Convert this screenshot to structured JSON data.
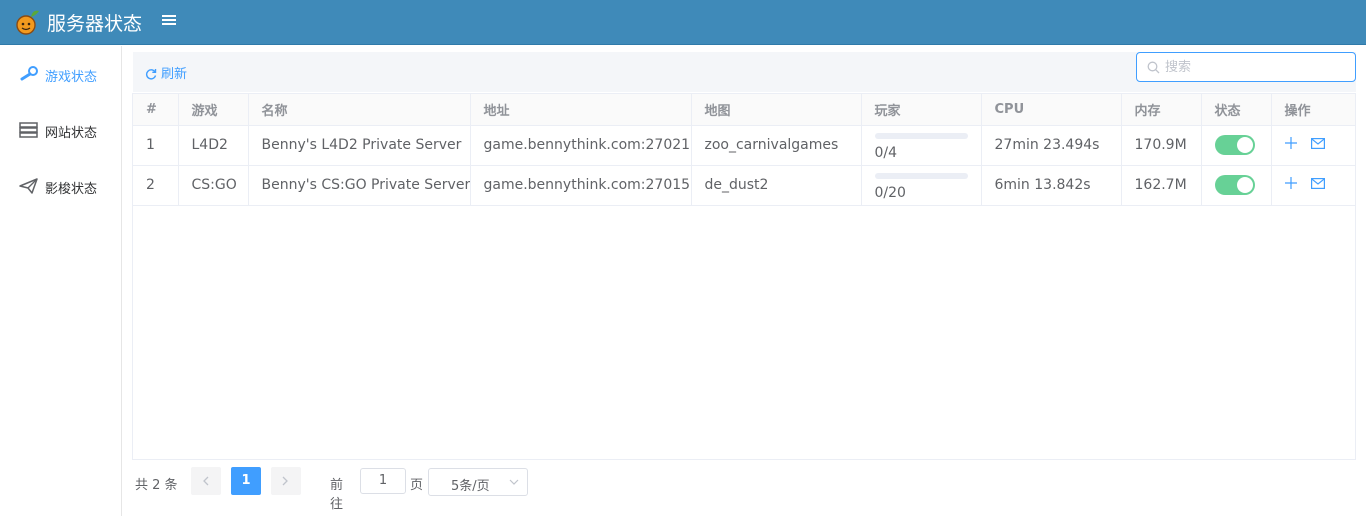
{
  "header": {
    "title": "服务器状态",
    "menu_icon": "hamburger-icon"
  },
  "sidebar": {
    "items": [
      {
        "label": "游戏状态",
        "icon": "steam-icon",
        "active": true
      },
      {
        "label": "网站状态",
        "icon": "server-icon",
        "active": false
      },
      {
        "label": "影梭状态",
        "icon": "paper-plane-icon",
        "active": false
      }
    ]
  },
  "toolbar": {
    "refresh_label": "刷新",
    "search_placeholder": "搜索"
  },
  "table": {
    "headers": [
      "#",
      "游戏",
      "名称",
      "地址",
      "地图",
      "玩家",
      "CPU",
      "内存",
      "状态",
      "操作"
    ],
    "rows": [
      {
        "index": "1",
        "game": "L4D2",
        "name": "Benny's L4D2 Private Server",
        "address": "game.bennythink.com:27021",
        "map": "zoo_carnivalgames",
        "players": "0/4",
        "players_fraction": 0,
        "cpu": "27min 23.494s",
        "memory": "170.9M",
        "status_on": true
      },
      {
        "index": "2",
        "game": "CS:GO",
        "name": "Benny's CS:GO Private Server",
        "address": "game.bennythink.com:27015",
        "map": "de_dust2",
        "players": "0/20",
        "players_fraction": 0,
        "cpu": "6min 13.842s",
        "memory": "162.7M",
        "status_on": true
      }
    ]
  },
  "pagination": {
    "total_label": "共 2 条",
    "current_page": "1",
    "goto_label": "前往",
    "goto_value": "1",
    "page_label": "页",
    "page_size": "5条/页"
  },
  "colors": {
    "header": "#3f8ab9",
    "accent": "#409eff",
    "switch_on": "#67d196"
  }
}
